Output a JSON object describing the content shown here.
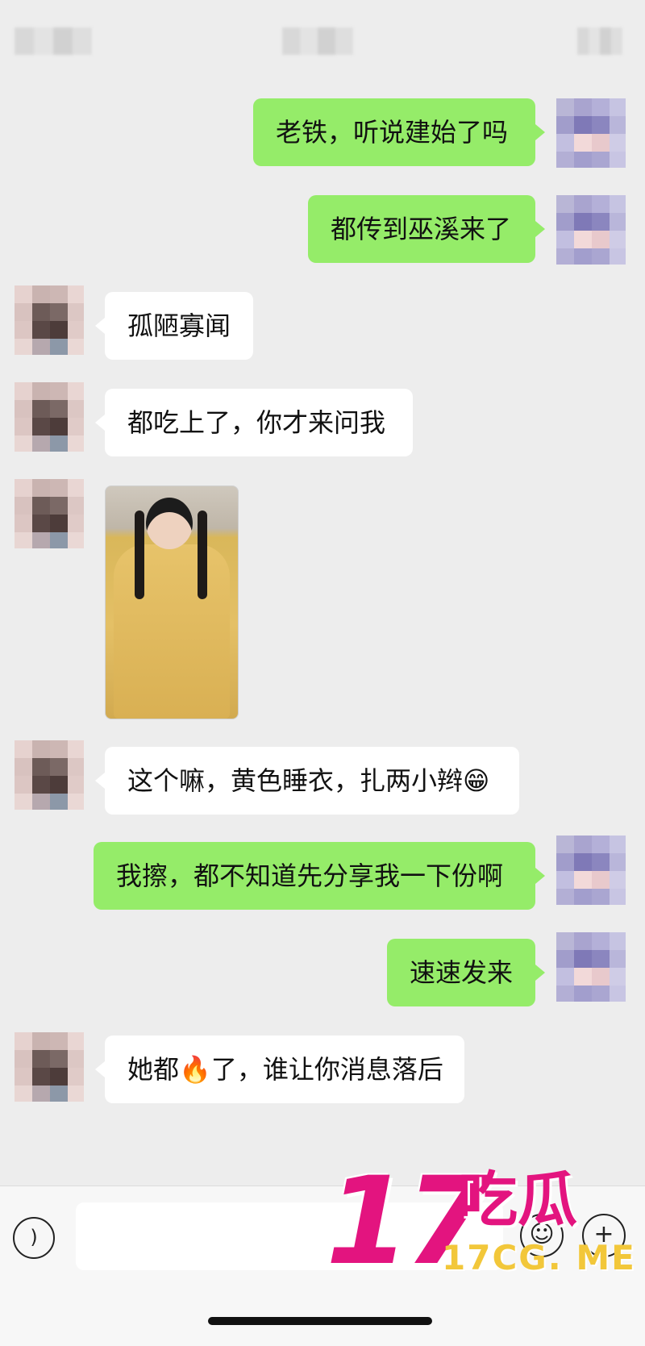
{
  "messages": [
    {
      "side": "right",
      "text": "老铁，听说建始了吗"
    },
    {
      "side": "right",
      "text": "都传到巫溪来了"
    },
    {
      "side": "left",
      "text": "孤陋寡闻"
    },
    {
      "side": "left",
      "text": "都吃上了，你才来问我"
    },
    {
      "side": "left",
      "type": "image"
    },
    {
      "side": "left",
      "text": "这个嘛，黄色睡衣，扎两小辫😁"
    },
    {
      "side": "right",
      "text": "我擦，都不知道先分享我一下份啊"
    },
    {
      "side": "right",
      "text": "速速发来"
    },
    {
      "side": "left",
      "text": "她都🔥了，谁让你消息落后"
    }
  ],
  "input_bar": {
    "voice_icon": "voice-icon",
    "emoji_icon": "smile-icon",
    "plus_icon": "plus-icon",
    "placeholder": ""
  },
  "watermark": {
    "number": "17",
    "cn": "吃瓜",
    "url": "17CG. ME"
  },
  "colors": {
    "background": "#ededed",
    "outgoing_bubble": "#95ec69",
    "incoming_bubble": "#ffffff",
    "watermark_pink": "#e3147f",
    "watermark_yellow": "#f2c73a"
  }
}
